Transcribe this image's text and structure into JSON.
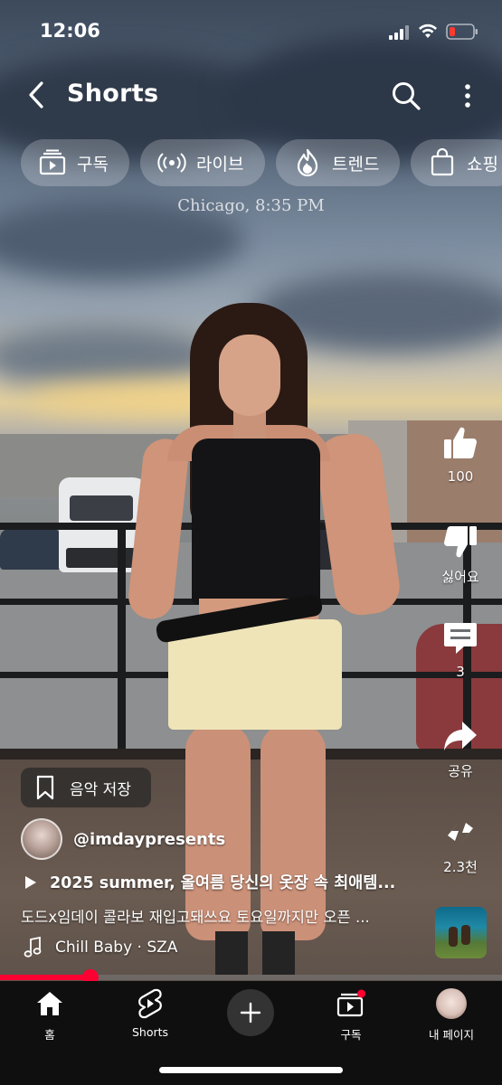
{
  "status_bar": {
    "time": "12:06"
  },
  "header": {
    "title": "Shorts"
  },
  "chips": [
    {
      "label": "구독",
      "icon": "subscriptions-icon"
    },
    {
      "label": "라이브",
      "icon": "live-icon"
    },
    {
      "label": "트렌드",
      "icon": "trending-flame-icon"
    },
    {
      "label": "쇼핑",
      "icon": "shopping-bag-icon"
    }
  ],
  "video": {
    "watermark": "Chicago, 8:35 PM",
    "progress_percent": 18
  },
  "actions": {
    "like_count": "100",
    "dislike_label": "싫어요",
    "comment_count": "3",
    "share_label": "공유",
    "remix_label": "2.3천"
  },
  "meta": {
    "save_music_label": "음악 저장",
    "channel_handle": "@imdaypresents",
    "title": "2025 summer, 올여름 당신의 옷장 속 최애템...",
    "description": "도드x임데이 콜라보 재입고돼쓰요 토요일까지만 오픈 ...",
    "music": "Chill Baby · SZA"
  },
  "nav": {
    "home": "홈",
    "shorts": "Shorts",
    "subscriptions": "구독",
    "my_page": "내 페이지"
  },
  "colors": {
    "accent": "#ff0033",
    "nav_bg": "#0f0f0f"
  }
}
